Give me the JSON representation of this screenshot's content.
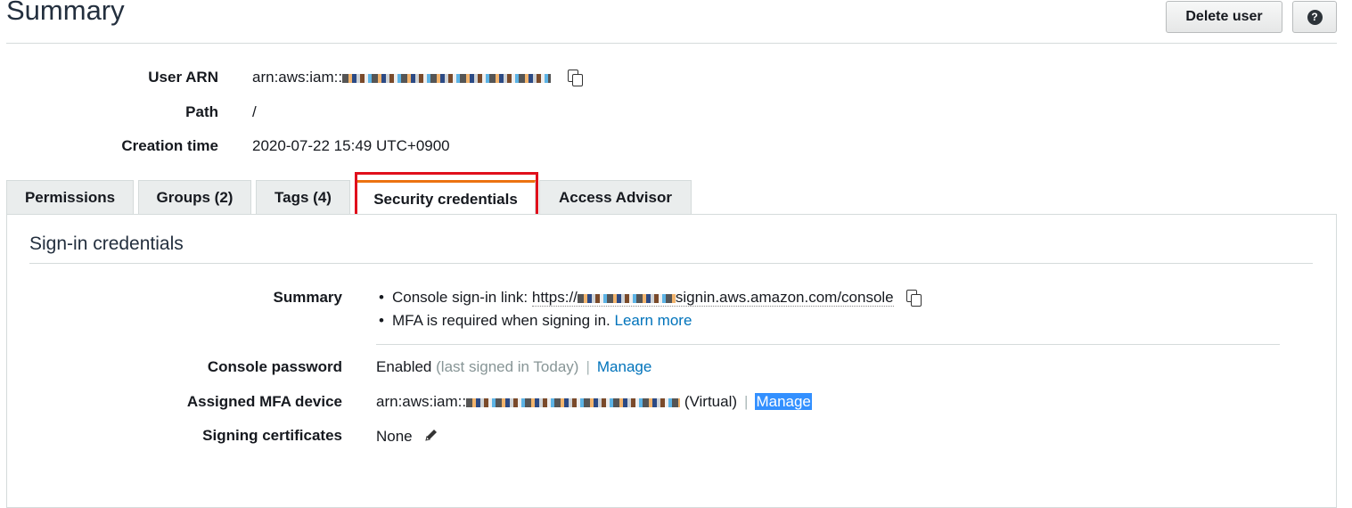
{
  "header": {
    "title": "Summary",
    "delete_button": "Delete user",
    "help_button": "?"
  },
  "meta": {
    "arn_label": "User ARN",
    "arn_value": "arn:aws:iam::",
    "path_label": "Path",
    "path_value": "/",
    "creation_label": "Creation time",
    "creation_value": "2020-07-22 15:49 UTC+0900"
  },
  "tabs": [
    {
      "label": "Permissions"
    },
    {
      "label": "Groups (2)"
    },
    {
      "label": "Tags (4)"
    },
    {
      "label": "Security credentials"
    },
    {
      "label": "Access Advisor"
    }
  ],
  "signin": {
    "section_title": "Sign-in credentials",
    "summary_label": "Summary",
    "console_link_prefix": "Console sign-in link:",
    "console_link_start": "https://",
    "console_link_end": "signin.aws.amazon.com/console",
    "mfa_text": "MFA is required when signing in.",
    "learn_more": "Learn more",
    "password_label": "Console password",
    "password_status": "Enabled",
    "password_detail": "(last signed in Today)",
    "password_manage": "Manage",
    "mfa_label": "Assigned MFA device",
    "mfa_value": "arn:aws:iam::",
    "mfa_type": "(Virtual)",
    "mfa_manage": "Manage",
    "certs_label": "Signing certificates",
    "certs_value": "None"
  },
  "colors": {
    "active_tab_accent": "#ec7211",
    "link": "#0073bb",
    "highlight_box": "#e0101c",
    "selection": "#3390ff"
  },
  "icons": {
    "copy": "copy-icon",
    "edit": "pencil-icon",
    "help": "help-icon"
  }
}
